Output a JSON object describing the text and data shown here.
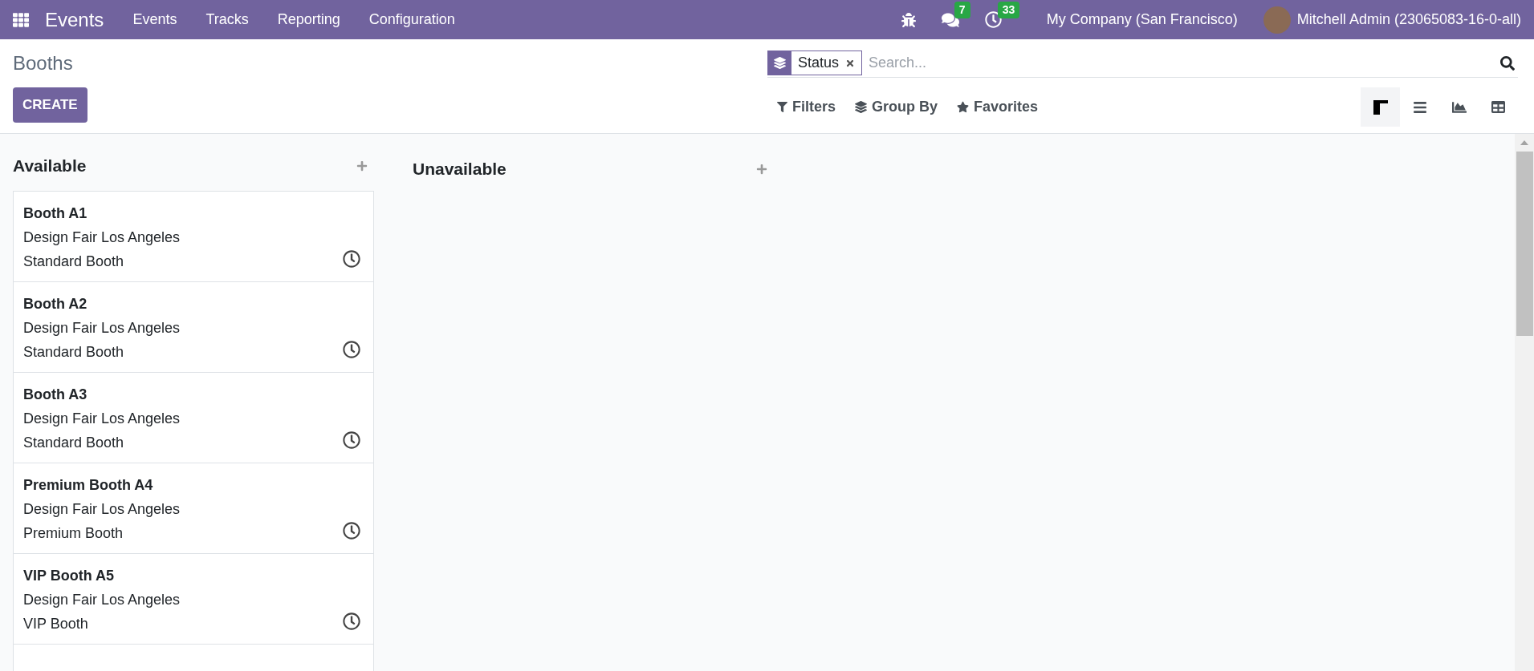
{
  "navbar": {
    "app_name": "Events",
    "menu": [
      "Events",
      "Tracks",
      "Reporting",
      "Configuration"
    ],
    "messages_count": "7",
    "activities_count": "33",
    "company": "My Company (San Francisco)",
    "user": "Mitchell Admin (23065083-16-0-all)"
  },
  "control_panel": {
    "title": "Booths",
    "create_label": "CREATE",
    "search": {
      "facet": "Status",
      "placeholder": "Search..."
    },
    "filters": [
      {
        "kind": "filter",
        "label": "Filters"
      },
      {
        "kind": "groupby",
        "label": "Group By"
      },
      {
        "kind": "favorites",
        "label": "Favorites"
      }
    ],
    "views": [
      {
        "kind": "kanban",
        "selected": true
      },
      {
        "kind": "list",
        "selected": false
      },
      {
        "kind": "graph",
        "selected": false
      },
      {
        "kind": "pivot",
        "selected": false
      }
    ]
  },
  "columns": [
    {
      "title": "Available",
      "cards": [
        {
          "name": "Booth A1",
          "event": "Design Fair Los Angeles",
          "category": "Standard Booth"
        },
        {
          "name": "Booth A2",
          "event": "Design Fair Los Angeles",
          "category": "Standard Booth"
        },
        {
          "name": "Booth A3",
          "event": "Design Fair Los Angeles",
          "category": "Standard Booth"
        },
        {
          "name": "Premium Booth A4",
          "event": "Design Fair Los Angeles",
          "category": "Premium Booth"
        },
        {
          "name": "VIP Booth A5",
          "event": "Design Fair Los Angeles",
          "category": "VIP Booth"
        }
      ],
      "more_cards": true
    },
    {
      "title": "Unavailable"
    }
  ]
}
